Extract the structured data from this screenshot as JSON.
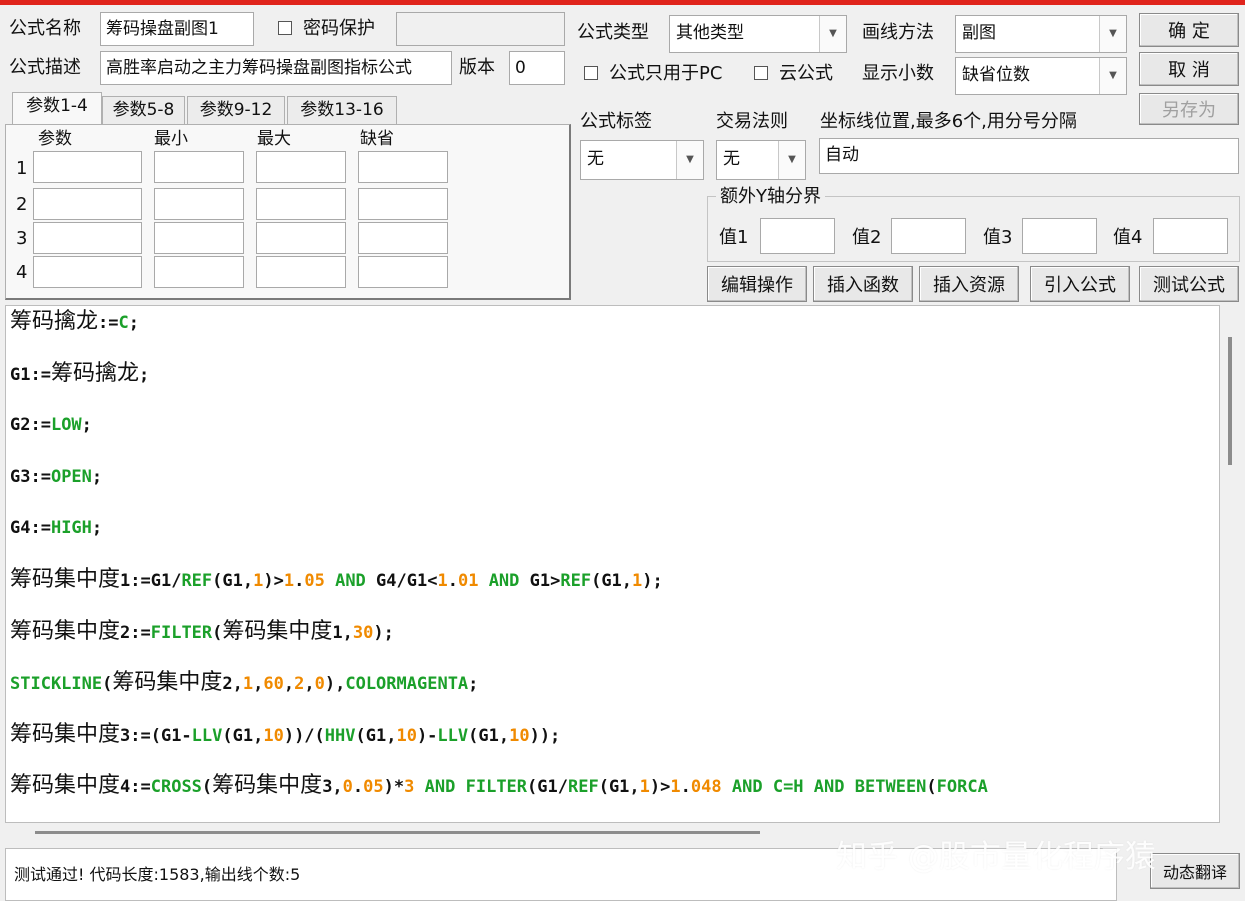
{
  "header": {
    "formula_name_label": "公式名称",
    "formula_name_value": "筹码操盘副图1",
    "password_protect_label": "密码保护",
    "formula_desc_label": "公式描述",
    "formula_desc_value": "高胜率启动之主力筹码操盘副图指标公式",
    "version_label": "版本",
    "version_value": "0",
    "formula_type_label": "公式类型",
    "formula_type_value": "其他类型",
    "draw_method_label": "画线方法",
    "draw_method_value": "副图",
    "pc_only_label": "公式只用于PC",
    "cloud_formula_label": "云公式",
    "show_decimal_label": "显示小数",
    "show_decimal_value": "缺省位数"
  },
  "buttons": {
    "ok": "确  定",
    "cancel": "取  消",
    "save_as": "另存为",
    "edit_ops": "编辑操作",
    "insert_func": "插入函数",
    "insert_res": "插入资源",
    "import_formula": "引入公式",
    "test_formula": "测试公式",
    "dynamic_translate": "动态翻译"
  },
  "param_tabs": [
    "参数1-4",
    "参数5-8",
    "参数9-12",
    "参数13-16"
  ],
  "param_headers": [
    "参数",
    "最小",
    "最大",
    "缺省"
  ],
  "param_rows": [
    "1",
    "2",
    "3",
    "4"
  ],
  "tags": {
    "formula_tag_label": "公式标签",
    "formula_tag_value": "无",
    "trade_rule_label": "交易法则",
    "trade_rule_value": "无",
    "coord_label": "坐标线位置,最多6个,用分号分隔",
    "coord_value": "自动"
  },
  "y_axis": {
    "title": "额外Y轴分界",
    "v1": "值1",
    "v2": "值2",
    "v3": "值3",
    "v4": "值4"
  },
  "colors": {
    "function": "#1ba02a",
    "number": "#f08a00",
    "top_bar": "#e0241c"
  },
  "code": [
    [
      [
        "cn",
        "筹码擒龙"
      ],
      [
        "t",
        ":="
      ],
      [
        "f",
        "C"
      ],
      [
        "t",
        ";"
      ]
    ],
    [
      [
        "t",
        "G1:="
      ],
      [
        "cn",
        "筹码擒龙"
      ],
      [
        "t",
        ";"
      ]
    ],
    [
      [
        "t",
        "G2:="
      ],
      [
        "f",
        "LOW"
      ],
      [
        "t",
        ";"
      ]
    ],
    [
      [
        "t",
        "G3:="
      ],
      [
        "f",
        "OPEN"
      ],
      [
        "t",
        ";"
      ]
    ],
    [
      [
        "t",
        "G4:="
      ],
      [
        "f",
        "HIGH"
      ],
      [
        "t",
        ";"
      ]
    ],
    [
      [
        "cn",
        "筹码集中度"
      ],
      [
        "t",
        "1:=G1/"
      ],
      [
        "f",
        "REF"
      ],
      [
        "t",
        "(G1,"
      ],
      [
        "n",
        "1"
      ],
      [
        "t",
        ")>"
      ],
      [
        "n",
        "1"
      ],
      [
        "t",
        "."
      ],
      [
        "n",
        "05"
      ],
      [
        "t",
        " "
      ],
      [
        "f",
        "AND"
      ],
      [
        "t",
        " G4/G1<"
      ],
      [
        "n",
        "1"
      ],
      [
        "t",
        "."
      ],
      [
        "n",
        "01"
      ],
      [
        "t",
        " "
      ],
      [
        "f",
        "AND"
      ],
      [
        "t",
        " G1>"
      ],
      [
        "f",
        "REF"
      ],
      [
        "t",
        "(G1,"
      ],
      [
        "n",
        "1"
      ],
      [
        "t",
        ");"
      ]
    ],
    [
      [
        "cn",
        "筹码集中度"
      ],
      [
        "t",
        "2:="
      ],
      [
        "f",
        "FILTER"
      ],
      [
        "t",
        "("
      ],
      [
        "cn",
        "筹码集中度"
      ],
      [
        "t",
        "1,"
      ],
      [
        "n",
        "30"
      ],
      [
        "t",
        ");"
      ]
    ],
    [
      [
        "f",
        "STICKLINE"
      ],
      [
        "t",
        "("
      ],
      [
        "cn",
        "筹码集中度"
      ],
      [
        "t",
        "2,"
      ],
      [
        "n",
        "1"
      ],
      [
        "t",
        ","
      ],
      [
        "n",
        "60"
      ],
      [
        "t",
        ","
      ],
      [
        "n",
        "2"
      ],
      [
        "t",
        ","
      ],
      [
        "n",
        "0"
      ],
      [
        "t",
        "),"
      ],
      [
        "f",
        "COLORMAGENTA"
      ],
      [
        "t",
        ";"
      ]
    ],
    [
      [
        "cn",
        "筹码集中度"
      ],
      [
        "t",
        "3:=(G1-"
      ],
      [
        "f",
        "LLV"
      ],
      [
        "t",
        "(G1,"
      ],
      [
        "n",
        "10"
      ],
      [
        "t",
        "))/("
      ],
      [
        "f",
        "HHV"
      ],
      [
        "t",
        "(G1,"
      ],
      [
        "n",
        "10"
      ],
      [
        "t",
        ")-"
      ],
      [
        "f",
        "LLV"
      ],
      [
        "t",
        "(G1,"
      ],
      [
        "n",
        "10"
      ],
      [
        "t",
        "));"
      ]
    ],
    [
      [
        "cn",
        "筹码集中度"
      ],
      [
        "t",
        "4:="
      ],
      [
        "f",
        "CROSS"
      ],
      [
        "t",
        "("
      ],
      [
        "cn",
        "筹码集中度"
      ],
      [
        "t",
        "3,"
      ],
      [
        "n",
        "0"
      ],
      [
        "t",
        "."
      ],
      [
        "n",
        "05"
      ],
      [
        "t",
        ")*"
      ],
      [
        "n",
        "3"
      ],
      [
        "t",
        " "
      ],
      [
        "f",
        "AND"
      ],
      [
        "t",
        " "
      ],
      [
        "f",
        "FILTER"
      ],
      [
        "t",
        "(G1/"
      ],
      [
        "f",
        "REF"
      ],
      [
        "t",
        "(G1,"
      ],
      [
        "n",
        "1"
      ],
      [
        "t",
        ")>"
      ],
      [
        "n",
        "1"
      ],
      [
        "t",
        "."
      ],
      [
        "n",
        "048"
      ],
      [
        "t",
        " "
      ],
      [
        "f",
        "AND"
      ],
      [
        "t",
        " "
      ],
      [
        "f",
        "C=H"
      ],
      [
        "t",
        " "
      ],
      [
        "f",
        "AND"
      ],
      [
        "t",
        " "
      ],
      [
        "f",
        "BETWEEN"
      ],
      [
        "t",
        "("
      ],
      [
        "f",
        "FORCA"
      ]
    ]
  ],
  "status_text": "测试通过! 代码长度:1583,输出线个数:5",
  "watermark": "知乎 @股市量化程序猿"
}
